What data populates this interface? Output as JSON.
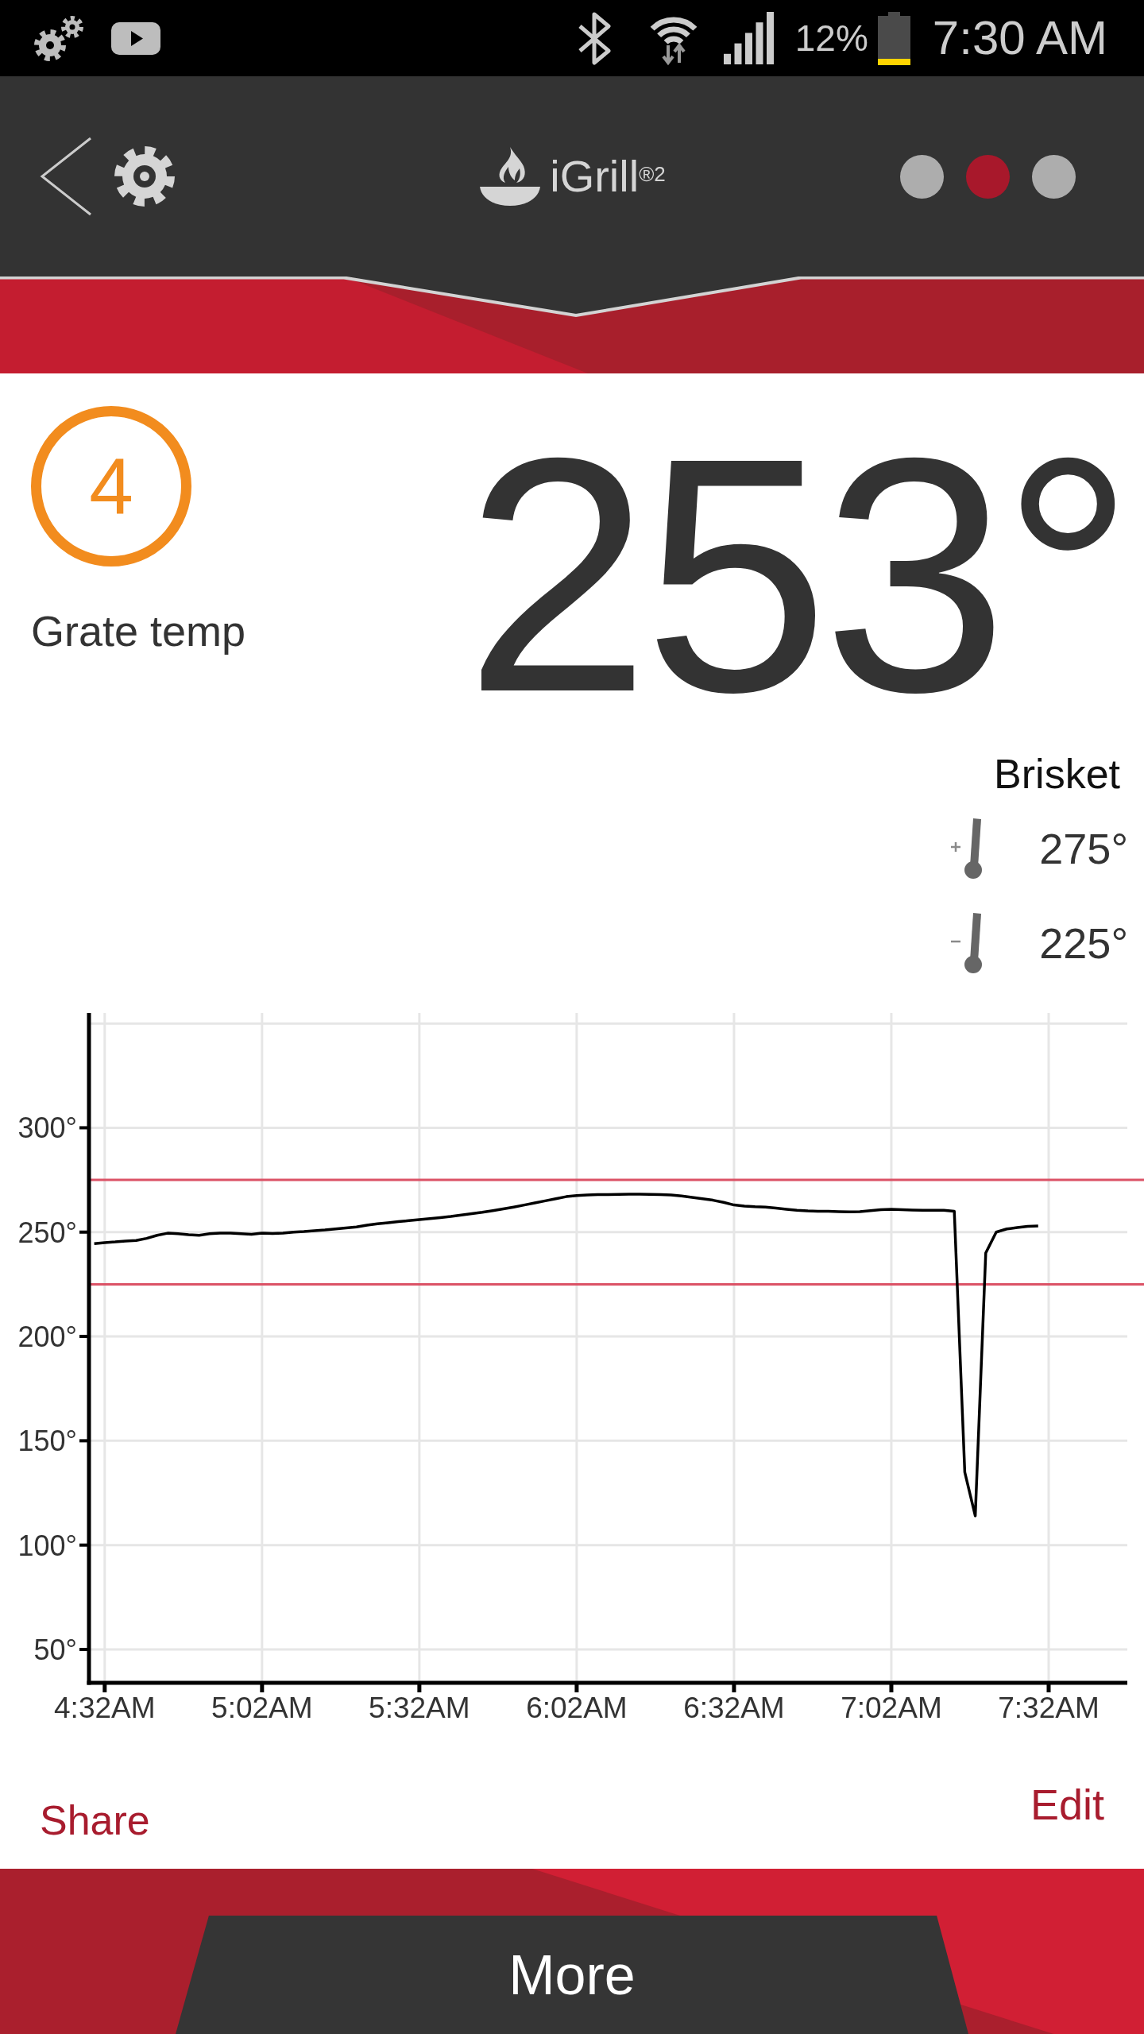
{
  "status_bar": {
    "battery_percent": "12%",
    "time": "7:30 AM"
  },
  "header": {
    "logo_text": "iGrill$^{®2}$",
    "pages": [
      {
        "selected": false
      },
      {
        "selected": true
      },
      {
        "selected": false
      }
    ]
  },
  "probe": {
    "number": "4",
    "label": "Grate temp",
    "temperature": "253°",
    "name": "Brisket",
    "alarms": [
      {
        "kind": "high",
        "value": "275°"
      },
      {
        "kind": "low",
        "value": "225°"
      }
    ]
  },
  "chart_data": {
    "type": "line",
    "grid": true,
    "categories": [
      null,
      "4:32AM",
      null,
      null,
      null,
      null,
      null,
      null,
      null,
      null,
      null,
      null,
      null,
      null,
      null,
      null,
      "5:02AM",
      null,
      null,
      null,
      null,
      null,
      null,
      null,
      null,
      null,
      null,
      null,
      null,
      null,
      null,
      "5:32AM",
      null,
      null,
      null,
      null,
      null,
      null,
      null,
      null,
      null,
      null,
      null,
      null,
      null,
      null,
      "6:02AM",
      null,
      null,
      null,
      null,
      null,
      null,
      null,
      null,
      null,
      null,
      null,
      null,
      null,
      null,
      "6:32AM",
      null,
      null,
      null,
      null,
      null,
      null,
      null,
      null,
      null,
      null,
      null,
      null,
      null,
      null,
      "7:02AM",
      null,
      null,
      null,
      null,
      null,
      null,
      null,
      null,
      null,
      null,
      null,
      null,
      null,
      null,
      "7:32AM",
      null,
      null,
      null,
      null,
      null,
      null,
      null
    ],
    "series": [
      {
        "color": "#000000",
        "values": [
          244.5,
          245,
          245.3,
          245.7,
          246,
          247,
          248.5,
          249.5,
          249.2,
          248.8,
          248.5,
          249.2,
          249.5,
          249.5,
          249.2,
          249,
          249.5,
          249.3,
          249.5,
          250,
          250.3,
          250.7,
          251,
          251.5,
          252,
          252.5,
          253.3,
          254,
          254.5,
          255,
          255.5,
          256,
          256.5,
          257,
          257.5,
          258.2,
          258.8,
          259.5,
          260.3,
          261.1,
          262,
          263,
          264,
          265,
          266,
          267,
          267.5,
          267.8,
          268,
          268,
          268.1,
          268.2,
          268.2,
          268.1,
          268,
          267.8,
          267.3,
          266.7,
          266,
          265.3,
          264.3,
          263,
          262.5,
          262.2,
          262,
          261.5,
          261,
          260.5,
          260.2,
          260,
          260,
          259.8,
          259.7,
          259.8,
          260.3,
          260.8,
          261,
          260.8,
          260.6,
          260.5,
          260.5,
          260.5,
          260,
          135,
          114,
          240,
          250,
          251.5,
          252.2,
          252.8,
          253,
          null,
          null,
          null,
          null,
          null,
          null,
          null,
          null
        ]
      }
    ],
    "ylim": [
      34,
      355
    ],
    "yticks": [
      {
        "value": 50,
        "label": "50°"
      },
      {
        "value": 100,
        "label": "100°"
      },
      {
        "value": 150,
        "label": "150°"
      },
      {
        "value": 200,
        "label": "200°"
      },
      {
        "value": 250,
        "label": "250°"
      },
      {
        "value": 300,
        "label": "300°"
      }
    ],
    "ref_lines": [
      {
        "axis": "y",
        "value": 275
      },
      {
        "axis": "y",
        "value": 225
      }
    ]
  },
  "actions": [
    {
      "label": "Share"
    },
    {
      "label": "Edit"
    }
  ],
  "more_button": {
    "label": "More"
  }
}
